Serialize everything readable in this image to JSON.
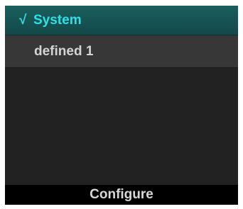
{
  "menu": {
    "items": [
      {
        "label": "System",
        "selected": true,
        "check_glyph": "√"
      },
      {
        "label": "defined 1",
        "selected": false
      }
    ]
  },
  "softkey": {
    "label": "Configure"
  },
  "colors": {
    "selected_bg": "#1a5f5f",
    "selected_text": "#2fe0e4",
    "item_bg": "#373737",
    "item_text": "#d4d4d4",
    "screen_bg": "#222222",
    "softkey_bg": "#000000"
  }
}
